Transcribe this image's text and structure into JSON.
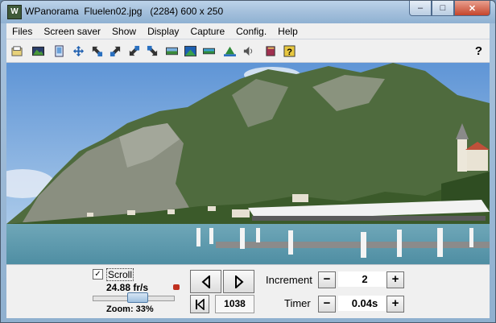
{
  "window": {
    "title": "WPanorama  Fluelen02.jpg   (2284) 600 x 250",
    "icon": "panorama-app-icon"
  },
  "caption_buttons": {
    "minimize": "–",
    "maximize": "□",
    "close": "✕"
  },
  "menu": [
    "Files",
    "Screen saver",
    "Show",
    "Display",
    "Capture",
    "Config.",
    "Help"
  ],
  "toolbar": {
    "icons": [
      "open-folder-icon",
      "landscape-image-icon",
      "page-icon",
      "move-icon",
      "arrow-up-left-icon",
      "arrow-up-right-icon",
      "arrow-down-left-icon",
      "arrow-down-right-icon",
      "panorama-icon",
      "panorama-blue-icon",
      "panorama-strip-icon",
      "mountain-icon",
      "speaker-icon",
      "book-icon",
      "help-info-icon"
    ],
    "help_label": "?"
  },
  "photo": {
    "description_icon": "lake-panorama-image"
  },
  "controls": {
    "scroll_label": "Scroll",
    "scroll_checked": "✓",
    "fps": "24.88 fr/s",
    "zoom": "Zoom: 33%",
    "zoom_fraction": 0.33,
    "frame_number": "1038",
    "increment_label": "Increment",
    "increment_value": "2",
    "timer_label": "Timer",
    "timer_value": "0.04s",
    "minus": "−",
    "plus": "+"
  },
  "colors": {
    "accent": "#7fa6cc",
    "close": "#c5452c"
  }
}
